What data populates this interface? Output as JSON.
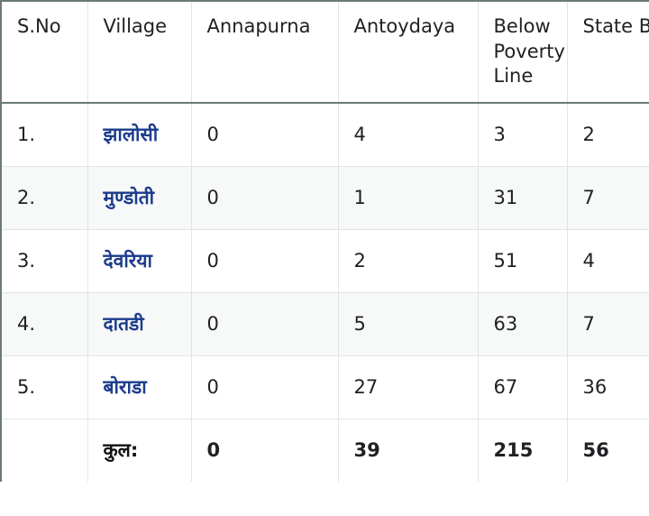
{
  "table": {
    "columns": [
      "S.No",
      "Village",
      "Annapurna",
      "Antoydaya",
      "Below Poverty Line",
      "State BPL"
    ],
    "rows": [
      {
        "sno": "1.",
        "village": "झालोसी",
        "annapurna": "0",
        "antoydaya": "4",
        "bpl": "3",
        "state_bpl": "2"
      },
      {
        "sno": "2.",
        "village": "मुण्डोती",
        "annapurna": "0",
        "antoydaya": "1",
        "bpl": "31",
        "state_bpl": "7"
      },
      {
        "sno": "3.",
        "village": "देवरिया",
        "annapurna": "0",
        "antoydaya": "2",
        "bpl": "51",
        "state_bpl": "4"
      },
      {
        "sno": "4.",
        "village": "दातडी",
        "annapurna": "0",
        "antoydaya": "5",
        "bpl": "63",
        "state_bpl": "7"
      },
      {
        "sno": "5.",
        "village": "बोराडा",
        "annapurna": "0",
        "antoydaya": "27",
        "bpl": "67",
        "state_bpl": "36"
      }
    ],
    "total": {
      "sno": "",
      "village": "कुल:",
      "annapurna": "0",
      "antoydaya": "39",
      "bpl": "215",
      "state_bpl": "56"
    },
    "link_color": "#1b3c8c"
  }
}
